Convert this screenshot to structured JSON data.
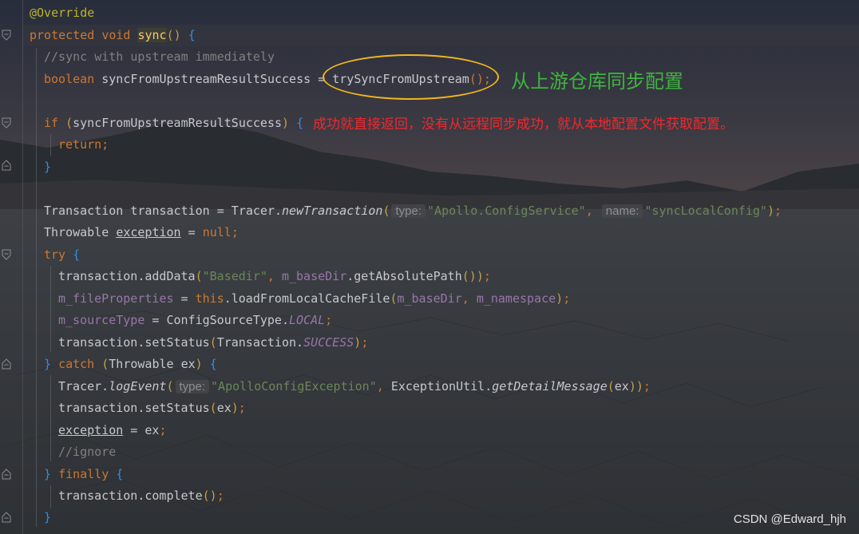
{
  "colors": {
    "keyword": "#cc7832",
    "annotation": "#bbb529",
    "string": "#6a8759",
    "field": "#9876aa",
    "comment": "#808080",
    "method_decl": "#ffc66d",
    "brace": "#2f8ee6",
    "note_green": "#3fb33f",
    "note_red": "#f0282d",
    "ellipse": "#f2b51c"
  },
  "icons": [
    "fold-open-icon",
    "fold-close-icon"
  ],
  "code": {
    "l1": {
      "annotation": "@Override"
    },
    "l2": {
      "protected": "protected",
      "void": "void",
      "name": "sync",
      "rest": "()"
    },
    "l3": {
      "comment": "//sync with upstream immediately"
    },
    "l4": {
      "type": "boolean",
      "var": "syncFromUpstreamResultSuccess",
      "eq": "=",
      "call": "trySyncFromUpstream",
      "end": "();"
    },
    "l6": {
      "if": "if",
      "cond": "syncFromUpstreamResultSuccess"
    },
    "l7": {
      "ret": "return;"
    },
    "l9": {
      "decl": "Transaction transaction = Tracer.",
      "method": "newTransaction",
      "hint_type": "type:",
      "arg1": "\"Apollo.ConfigService\"",
      "hint_name": "name:",
      "arg2": "\"syncLocalConfig\"",
      "end": ");"
    },
    "l10": {
      "decl": "Throwable ",
      "var": "exception",
      "eq": " = ",
      "val": "null",
      "end": ";"
    },
    "l11": {
      "try": "try"
    },
    "l12": {
      "a": "transaction.addData",
      "s": "\"Basedir\"",
      "f": "m_baseDir",
      "b": ".getAbsolutePath",
      "end": "());"
    },
    "l13": {
      "f": "m_fileProperties",
      "eq": " = ",
      "this": "this",
      "call": ".loadFromLocalCacheFile",
      "a1": "m_baseDir",
      "a2": "m_namespace",
      "end": ");"
    },
    "l14": {
      "f": "m_sourceType",
      "eq": " = ConfigSourceType.",
      "c": "LOCAL",
      "end": ";"
    },
    "l15": {
      "a": "transaction.setStatus",
      "b": "Transaction.",
      "c": "SUCCESS",
      "end": ");"
    },
    "l16": {
      "catch": "catch",
      "param": "Throwable ex"
    },
    "l17": {
      "a": "Tracer.",
      "m": "logEvent",
      "hint_type": "type:",
      "s": "\"ApolloConfigException\"",
      "b": "ExceptionUtil.",
      "m2": "getDetailMessage",
      "arg": "ex",
      "end": "));"
    },
    "l18": {
      "a": "transaction.setStatus",
      "arg": "ex",
      "end": ");"
    },
    "l19": {
      "var": "exception",
      "rest": " = ex",
      "end": ";"
    },
    "l20": {
      "comment": "//ignore"
    },
    "l21": {
      "finally": "finally"
    },
    "l22": {
      "a": "transaction.complete",
      "end": "();"
    }
  },
  "notes": {
    "green": "从上游仓库同步配置",
    "red": "成功就直接返回，没有从远程同步成功，就从本地配置文件获取配置。"
  },
  "watermark": "CSDN @Edward_hjh"
}
